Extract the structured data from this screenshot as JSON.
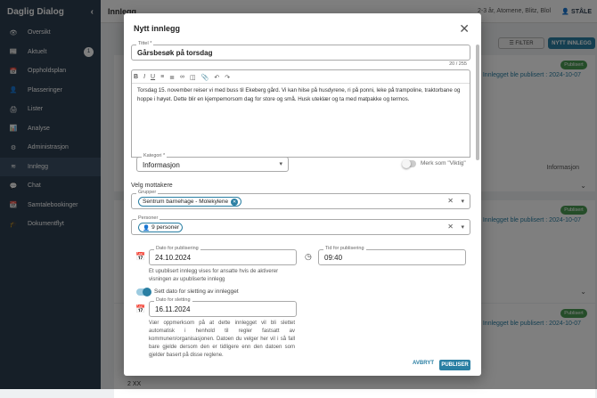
{
  "app": {
    "title": "Daglig Dialog"
  },
  "sidebar": {
    "items": [
      {
        "label": "Oversikt",
        "icon": "eye-icon"
      },
      {
        "label": "Aktuelt",
        "icon": "news-icon",
        "badge": "1"
      },
      {
        "label": "Oppholdsplan",
        "icon": "calendar-icon"
      },
      {
        "label": "Plasseringer",
        "icon": "person-card-icon"
      },
      {
        "label": "Lister",
        "icon": "printer-icon"
      },
      {
        "label": "Analyse",
        "icon": "chart-icon"
      },
      {
        "label": "Administrasjon",
        "icon": "admin-icon"
      },
      {
        "label": "Innlegg",
        "icon": "rss-icon",
        "active": true
      },
      {
        "label": "Chat",
        "icon": "chat-icon"
      },
      {
        "label": "Samtalebookinger",
        "icon": "calendar-booking-icon"
      },
      {
        "label": "Dokumentflyt",
        "icon": "graduation-cap-icon"
      }
    ]
  },
  "header": {
    "title": "Innlegg",
    "filter_selection": "2-3 år, Atomene, Blitz, Blol",
    "user_label": "STÅLE"
  },
  "toolbar": {
    "filter_label": "FILTER",
    "new_post_label": "NYTT INNLEGG"
  },
  "background_cards": [
    {
      "status": "Publisert",
      "published_text": "Innlegget ble publisert : 2024-10-07",
      "info": "Informasjon"
    },
    {
      "status": "Publisert",
      "published_text": "Innlegget ble publisert : 2024-10-07"
    },
    {
      "status": "Publisert",
      "published_text": "Innlegget ble publisert : 2024-10-07"
    }
  ],
  "background_footer": "2 XX",
  "modal": {
    "title": "Nytt innlegg",
    "title_field": {
      "label": "Tittel *",
      "value": "Gårsbesøk på torsdag",
      "counter": "20 / 255"
    },
    "body_text": "Torsdag 15. november reiser vi med buss til Ekeberg gård. Vi kan hilse på husdyrene, ri på ponni, leke på trampoline, traktorbane og hoppe i høyet. Dette blir en kjempemorsom dag for store og små. Husk uteklær og ta med matpakke og termos.",
    "category": {
      "label": "Kategori *",
      "value": "Informasjon"
    },
    "important_toggle": {
      "label": "Merk som \"Viktig\"",
      "on": false
    },
    "recipients_heading": "Velg mottakere",
    "groups": {
      "label": "Grupper",
      "chip": "Sentrum barnehage - Molekylene"
    },
    "persons": {
      "label": "Personer",
      "chip": "9 personer"
    },
    "publish_date": {
      "label": "Dato for publisering",
      "value": "24.10.2024"
    },
    "publish_time": {
      "label": "Tid for publisering",
      "value": "09:40"
    },
    "publish_help": "Et upublisert innlegg vises for ansatte hvis de aktiverer visningen av upubliserte innlegg",
    "delete_toggle": {
      "label": "Sett dato for sletting av innlegget",
      "on": true
    },
    "delete_date": {
      "label": "Dato for sletting",
      "value": "16.11.2024"
    },
    "delete_help": "Vær oppmerksom på at dette innlegget vil bli slettet automatisk i henhold til regler fastsatt av kommunen/organisasjonen. Datoen du velger her vil i så fall bare gjelde dersom den er tidligere enn den datoen som gjelder basert på disse reglene.",
    "cancel_label": "AVBRYT",
    "publish_label": "PUBLISER"
  },
  "colors": {
    "sidebar": "#2c3e50",
    "accent": "#2a7fa3",
    "published": "#4b9b52"
  }
}
